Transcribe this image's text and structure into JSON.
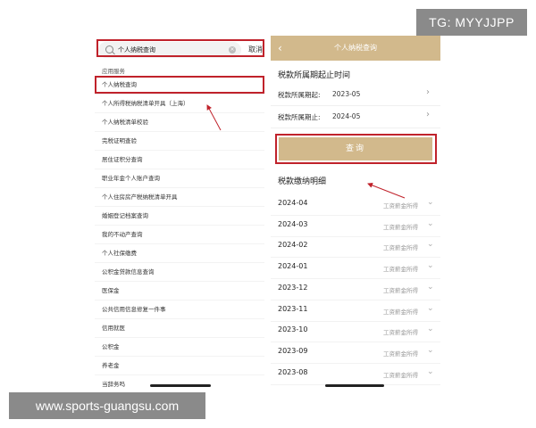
{
  "watermarks": {
    "tg": "TG: MYYJJPP",
    "url": "www.sports-guangsu.com"
  },
  "left_screen": {
    "search": {
      "query": "个人纳税查询",
      "cancel_label": "取消"
    },
    "section_label": "应用服务",
    "items": [
      {
        "label": "个人纳税查询"
      },
      {
        "label": "个人所得税纳税清单开具（上海）"
      },
      {
        "label": "个人纳税清单校验"
      },
      {
        "label": "完税证明查验"
      },
      {
        "label": "居住证积分查询"
      },
      {
        "label": "职业年金个人账户查询"
      },
      {
        "label": "个人住房房产税纳税清单开具"
      },
      {
        "label": "婚姻登记档案查询"
      },
      {
        "label": "我的不动产查询"
      },
      {
        "label": "个人社保缴费"
      },
      {
        "label": "公积金贷款信息查询"
      },
      {
        "label": "医保金"
      },
      {
        "label": "公共信用信息修复一件事"
      },
      {
        "label": "信用就医"
      },
      {
        "label": "公积金"
      },
      {
        "label": "养老金"
      },
      {
        "label": "当辞务吗"
      }
    ]
  },
  "right_screen": {
    "header_title": "个人纳税查询",
    "period_title": "税款所属期起止时间",
    "period_start": {
      "label": "税款所属期起:",
      "value": "2023-05"
    },
    "period_end": {
      "label": "税款所属期止:",
      "value": "2024-05"
    },
    "query_button": "查询",
    "detail_title": "税款缴纳明细",
    "records": [
      {
        "month": "2024-04",
        "type": "工资薪金所得"
      },
      {
        "month": "2024-03",
        "type": "工资薪金所得"
      },
      {
        "month": "2024-02",
        "type": "工资薪金所得"
      },
      {
        "month": "2024-01",
        "type": "工资薪金所得"
      },
      {
        "month": "2023-12",
        "type": "工资薪金所得"
      },
      {
        "month": "2023-11",
        "type": "工资薪金所得"
      },
      {
        "month": "2023-10",
        "type": "工资薪金所得"
      },
      {
        "month": "2023-09",
        "type": "工资薪金所得"
      },
      {
        "month": "2023-08",
        "type": "工资薪金所得"
      }
    ]
  },
  "colors": {
    "accent_gold": "#d2b98c",
    "highlight_red": "#c0222b"
  }
}
